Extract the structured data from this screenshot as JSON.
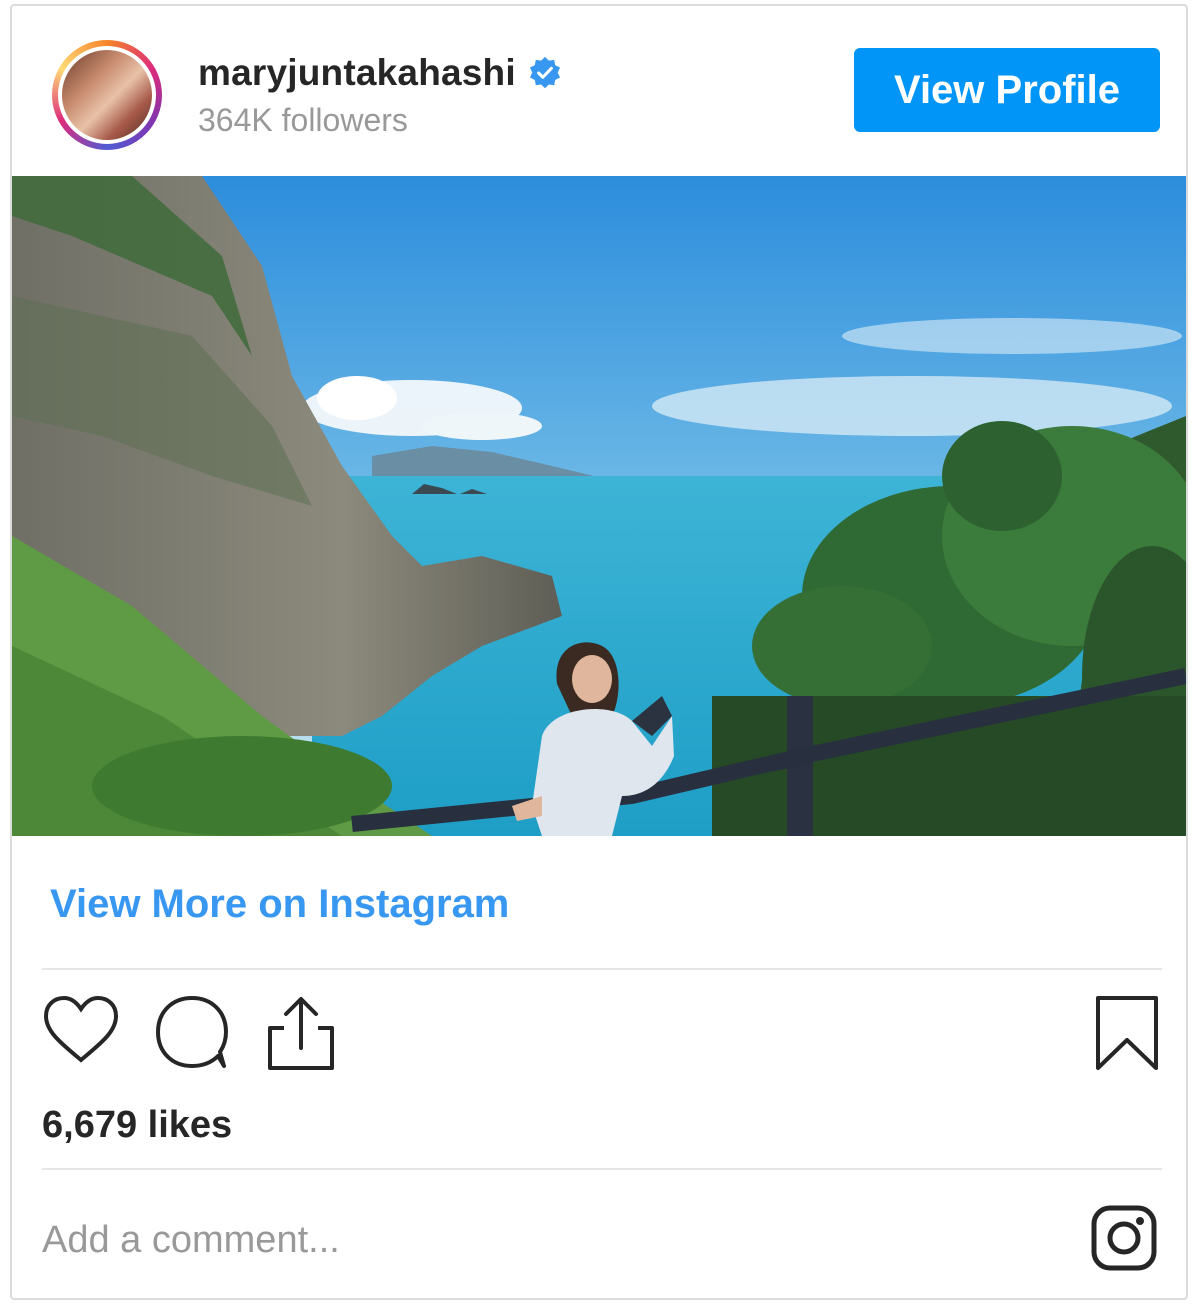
{
  "header": {
    "username": "maryjuntakahashi",
    "followers": "364K followers",
    "view_profile_label": "View Profile",
    "verified_color": "#3897f0"
  },
  "post": {
    "view_more_label": "View More on Instagram",
    "likes": "6,679 likes",
    "comment_placeholder": "Add a comment..."
  },
  "icons": [
    "heart-icon",
    "comment-icon",
    "share-icon",
    "bookmark-icon",
    "instagram-logo-icon",
    "verified-badge-icon"
  ],
  "colors": {
    "button": "#0095f6",
    "link": "#3897f0",
    "text": "#262626",
    "muted": "#999999"
  }
}
